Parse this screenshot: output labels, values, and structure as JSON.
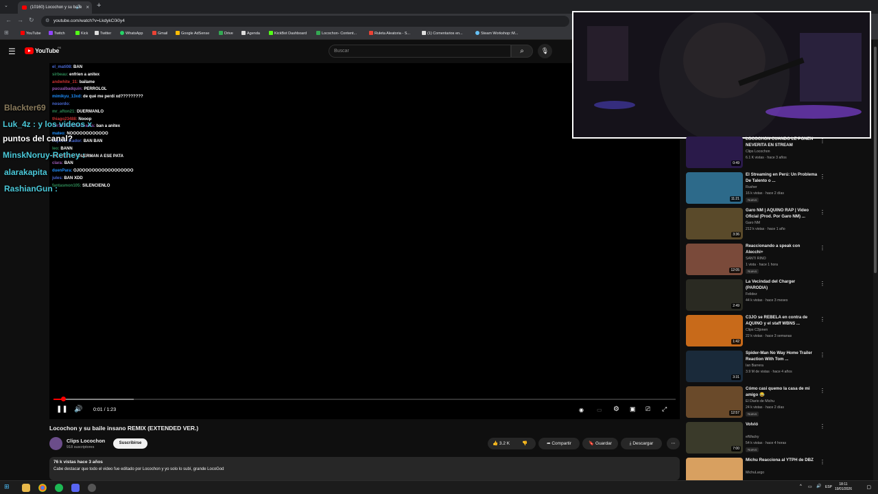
{
  "browser": {
    "tab_title": "(10160) Locochon y su baile",
    "url": "youtube.com/watch?v=LkdykC0i0y4",
    "bookmarks": [
      "YouTube",
      "Twitch",
      "Kick",
      "Twitter",
      "WhatsApp",
      "Gmail",
      "Google AdSense",
      "Drive",
      "Agenda",
      "KickBot Dashboard",
      "Locochon- Content...",
      "Ruleta Aleatoria - S...",
      "(1) Comentarios en...",
      "Steam Workshop::M..."
    ]
  },
  "youtube": {
    "country": "PE",
    "search_placeholder": "Buscar"
  },
  "player": {
    "time": "0:01 / 1:23",
    "progress_fraction": 0.012
  },
  "chat_overlay": [
    {
      "user": "el_mati08:",
      "msg": "BAN"
    },
    {
      "user": "sirbeau:",
      "msg": "enfrien a anitex"
    },
    {
      "user": "andwhite_31:",
      "msg": "bailame"
    },
    {
      "user": "pucualbadquin:",
      "msg": "PERROLOL"
    },
    {
      "user": "mimikyu_13xd:",
      "msg": "de qué me perdí xd?????????"
    },
    {
      "user": "nosordo:",
      "msg": ""
    },
    {
      "user": "mr_afton21:",
      "msg": "DUERMANLO"
    },
    {
      "user": "thiago23488:",
      "msg": "Nooop"
    },
    {
      "user": "cdr10303725oldeanfa:",
      "msg": "ban a anitex"
    },
    {
      "user": "mateo:",
      "msg": "NOOOOOOOOOOOO"
    },
    {
      "user": "espec0_0tador:",
      "msg": "BAN BAN"
    },
    {
      "user": "leo:",
      "msg": "BANN"
    },
    {
      "user": "xDogMan72:",
      "msg": "DUERMAN A ESE PATA"
    },
    {
      "user": "clara:",
      "msg": "BAN"
    },
    {
      "user": "duenPara:",
      "msg": "OJOOOOOOOOOOOOOOOOO"
    },
    {
      "user": "jules:",
      "msg": "BAN XDD"
    },
    {
      "user": "fantasmon105:",
      "msg": "SILENCIENLO"
    }
  ],
  "big_chat": [
    {
      "text": "Blackter69",
      "color": "#8a7b5c"
    },
    {
      "text": "Luk_4z : y los videos x",
      "color": "#4ac8d8"
    },
    {
      "text": "puntos del canal?",
      "color": "#ffffff"
    },
    {
      "text": "MinskNoruy-Rethey :",
      "color": "#4ac8d8"
    },
    {
      "text": "alarakapita",
      "color": "#4ac8d8"
    },
    {
      "text": "RashianGun :",
      "color": "#4ac8d8"
    }
  ],
  "video": {
    "title": "Locochon y su baile insano REMIX (EXTENDED VER.)",
    "channel": "Clips Locochon",
    "subscribers": "918 suscriptores",
    "subscribe_label": "Suscribirse",
    "likes": "3.2 K",
    "share_label": "Compartir",
    "save_label": "Guardar",
    "download_label": "Descargar",
    "meta": "76 k vistas  hace 3 años",
    "description": "Cabe destacar que todo el video fue editado por Locochon y yo solo lo subí, grande LocoGod"
  },
  "recommended": [
    {
      "title": "LOCOCHON CUANDO LE PONEN NEVERITA EN STREAM",
      "channel": "Clips Locochon",
      "views": "6.1 K vistas · hace 3 años",
      "dur": "0:49",
      "new": "",
      "thumb": "#2a1a4a"
    },
    {
      "title": "El Streaming en Perú: Un Problema De Talento o ...",
      "channel": "Rusher",
      "views": "16 k vistas · hace 2 días",
      "dur": "11:21",
      "new": "Nuevo",
      "thumb": "#2d6a8a"
    },
    {
      "title": "Garo NM | AQUINO RAP | Video Oficial (Prod. Por Garo NM) ...",
      "channel": "Garo NM",
      "views": "212 k vistas · hace 1 año",
      "dur": "3:36",
      "new": "",
      "thumb": "#5a4a2a"
    },
    {
      "title": "Reaccionando a speak con Alecchi+",
      "channel": "SANTI RINO",
      "views": "1 vista · hace 1 hora",
      "dur": "12:05",
      "new": "Nuevo",
      "thumb": "#7a4a3a"
    },
    {
      "title": "La Vecindad del Charger (PARODIA)",
      "channel": "Felidez",
      "views": "44 k vistas · hace 3 meses",
      "dur": "2:49",
      "new": "",
      "thumb": "#2a2a22"
    },
    {
      "title": "C3JO se REBELA en contra de AQUINO y el staff WBNS ...",
      "channel": "Clips C3jonen",
      "views": "22 k vistas · hace 3 semanas",
      "dur": "1:42",
      "new": "",
      "thumb": "#c86a1a"
    },
    {
      "title": "Spider-Man No Way Home Trailer Reaction With Tom ...",
      "channel": "Ian Barrera",
      "views": "3.9 M de vistas · hace 4 años",
      "dur": "3:31",
      "new": "",
      "thumb": "#1a2a3a"
    },
    {
      "title": "Cómo casi quemo la casa de mi amigo 😂",
      "channel": "El Diario de Michu",
      "views": "24 k vistas · hace 2 días",
      "dur": "12:57",
      "new": "Nuevo",
      "thumb": "#6a4a2a"
    },
    {
      "title": "Volvió",
      "channel": "elWacky",
      "views": "54 k vistas · hace 4 horas",
      "dur": "7:00",
      "new": "Nuevo",
      "thumb": "#3a3a2a"
    },
    {
      "title": "Michu Reacciona al YTPH de DBZ",
      "channel": "MichuLargo",
      "views": "",
      "dur": "",
      "new": "",
      "thumb": "#d8a060"
    }
  ],
  "taskbar": {
    "lang": "ESP",
    "time": "18:11",
    "date": "19/01/2026"
  }
}
